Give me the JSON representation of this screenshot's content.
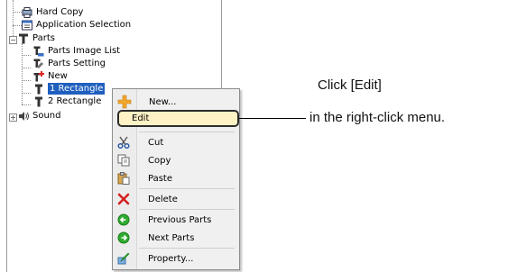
{
  "tree": {
    "items": [
      {
        "label": "Hard Copy",
        "icon": "hard-copy-icon"
      },
      {
        "label": "Application Selection",
        "icon": "application-selection-icon"
      },
      {
        "label": "Parts",
        "icon": "parts-icon"
      },
      {
        "label": "Parts Image List",
        "icon": "parts-image-list-icon"
      },
      {
        "label": "Parts Setting",
        "icon": "parts-setting-icon"
      },
      {
        "label": "New",
        "icon": "parts-new-icon"
      },
      {
        "label": "1 Rectangle",
        "icon": "rectangle-part-icon"
      },
      {
        "label": "2 Rectangle",
        "icon": "rectangle-part-icon"
      },
      {
        "label": "Sound",
        "icon": "sound-icon"
      }
    ]
  },
  "context_menu": {
    "items": [
      {
        "label": "New...",
        "icon": "new-plus-icon"
      },
      {
        "label": "Edit",
        "icon": ""
      },
      {
        "label": "Cut",
        "icon": "scissors-icon"
      },
      {
        "label": "Copy",
        "icon": "copy-icon"
      },
      {
        "label": "Paste",
        "icon": "paste-icon"
      },
      {
        "label": "Delete",
        "icon": "delete-x-icon"
      },
      {
        "label": "Previous Parts",
        "icon": "previous-arrow-icon"
      },
      {
        "label": "Next Parts",
        "icon": "next-arrow-icon"
      },
      {
        "label": "Property...",
        "icon": "property-icon"
      }
    ]
  },
  "callout": {
    "line1": "Click [Edit]",
    "line2": "in the right-click menu."
  },
  "colors": {
    "selection": "#1f5fbf",
    "edit_highlight": "#fff3c6",
    "delete_red": "#d62020",
    "nav_green": "#2faa2f"
  }
}
